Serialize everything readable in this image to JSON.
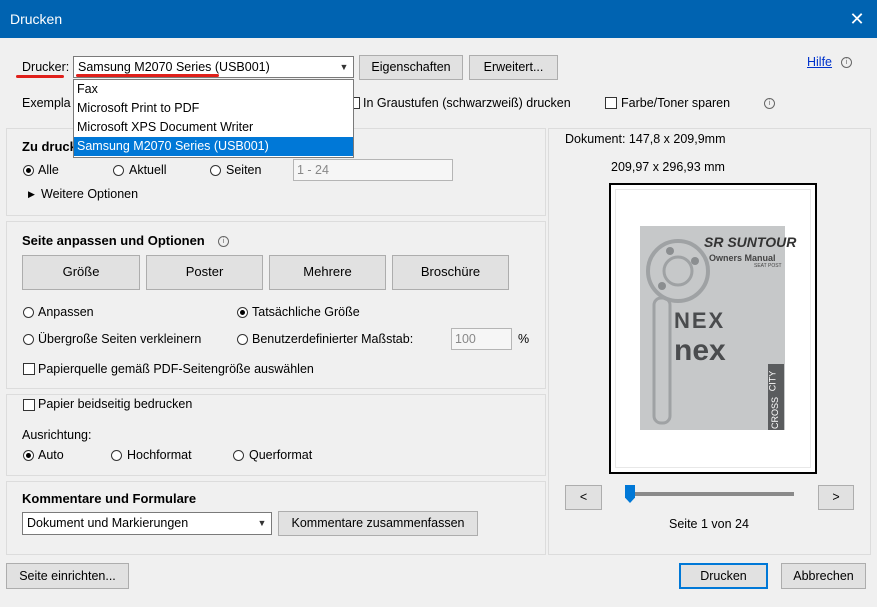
{
  "window": {
    "title": "Drucken",
    "close_glyph": "✕"
  },
  "printer": {
    "label": "Drucker:",
    "selected": "Samsung M2070 Series (USB001)",
    "options": [
      "Fax",
      "Microsoft Print to PDF",
      "Microsoft XPS Document Writer",
      "Samsung M2070 Series (USB001)"
    ],
    "properties_button": "Eigenschaften",
    "advanced_button": "Erweitert...",
    "help_link": "Hilfe"
  },
  "copies": {
    "label_partial": "Exempla"
  },
  "grayscale": {
    "label": "In Graustufen (schwarzweiß) drucken",
    "checked": false
  },
  "save_toner": {
    "label": "Farbe/Toner sparen",
    "checked": false
  },
  "pages": {
    "title_partial": "Zu druck",
    "all": "Alle",
    "current": "Aktuell",
    "pages": "Seiten",
    "range_placeholder": "1 - 24",
    "more_options": "Weitere Optionen"
  },
  "fit": {
    "title": "Seite anpassen und Optionen",
    "buttons": [
      "Größe",
      "Poster",
      "Mehrere",
      "Broschüre"
    ],
    "fit_label": "Anpassen",
    "actual_size": "Tatsächliche Größe",
    "shrink": "Übergroße Seiten verkleinern",
    "custom_scale": "Benutzerdefinierter Maßstab:",
    "scale_value": "100",
    "percent": "%",
    "paper_source": "Papierquelle gemäß PDF-Seitengröße auswählen"
  },
  "duplex": {
    "label": "Papier beidseitig bedrucken"
  },
  "orientation": {
    "label": "Ausrichtung:",
    "auto": "Auto",
    "portrait": "Hochformat",
    "landscape": "Querformat"
  },
  "comments": {
    "title": "Kommentare und Formulare",
    "selected": "Dokument und Markierungen",
    "summarize_button": "Kommentare zusammenfassen"
  },
  "preview": {
    "document_size": "Dokument: 147,8 x 209,9mm",
    "paper_size": "209,97 x 296,93 mm",
    "page_label": "Seite 1 von 24",
    "prev": "<",
    "next": ">",
    "cover": {
      "brand": "SR SUNTOUR",
      "manual": "Owners Manual",
      "sub": "SEAT POST",
      "model1": "NEX",
      "model2": "nex",
      "tag1": "CITY",
      "tag2": "CROSS"
    }
  },
  "footer": {
    "page_setup": "Seite einrichten...",
    "print": "Drucken",
    "cancel": "Abbrechen"
  },
  "colors": {
    "titlebar": "#0063b1",
    "selection": "#0078d7",
    "annotation_red": "#e0201b",
    "link": "#0033cc"
  },
  "icons": {
    "info": "info-icon",
    "dropdown": "chevron-down-icon",
    "expand": "triangle-right-icon"
  }
}
